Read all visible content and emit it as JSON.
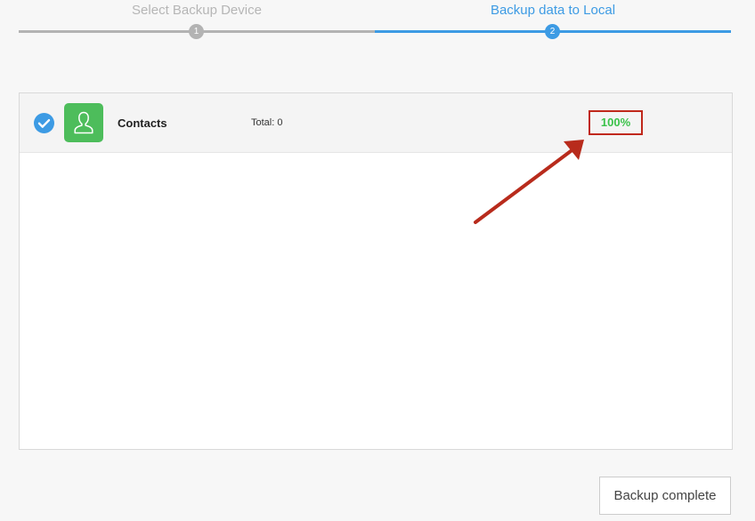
{
  "stepper": {
    "steps": [
      {
        "label": "Select Backup Device",
        "number": "1",
        "state": "completed"
      },
      {
        "label": "Backup data to Local",
        "number": "2",
        "state": "active"
      }
    ]
  },
  "backup_list": {
    "items": [
      {
        "name": "Contacts",
        "total": "Total: 0",
        "progress": "100%",
        "progress_value": 100,
        "checked": true,
        "icon": "contact-person-icon"
      }
    ]
  },
  "annotation": {
    "icon": "red-arrow-icon"
  },
  "footer": {
    "done_label": "Backup complete"
  },
  "colors": {
    "accent": "#3d9be4",
    "inactive": "#b3b3b3",
    "contacts_icon_bg": "#4dbd5b",
    "progress_text": "#3bc24a",
    "highlight": "#c0281b"
  }
}
